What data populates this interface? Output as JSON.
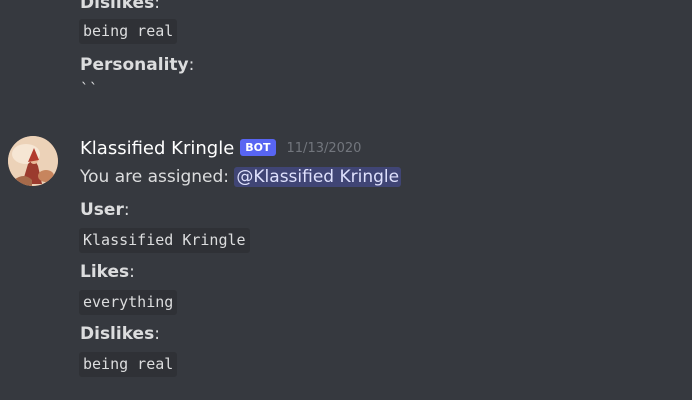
{
  "previous_message": {
    "dislikes_label": "Dislikes",
    "dislikes_value": "being real",
    "personality_label": "Personality",
    "personality_value": "``"
  },
  "message": {
    "username": "Klassified Kringle",
    "bot_tag": "BOT",
    "timestamp": "11/13/2020",
    "intro_text": "You are assigned:",
    "mention": "@Klassified Kringle",
    "user_label": "User",
    "user_value": "Klassified Kringle",
    "likes_label": "Likes",
    "likes_value": "everything",
    "dislikes_label": "Dislikes",
    "dislikes_value": "being real"
  },
  "colon": ":",
  "colors": {
    "background": "#36393f",
    "code_background": "#2f3136",
    "bot_tag": "#5865f2",
    "mention_bg": "#414675",
    "timestamp": "#72767d"
  }
}
